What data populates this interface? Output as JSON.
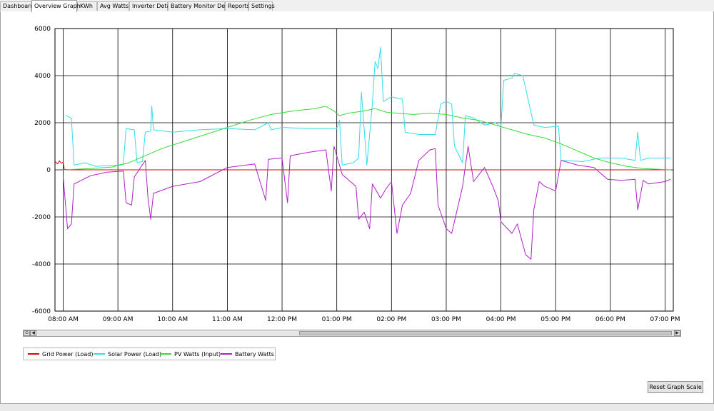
{
  "tabs": [
    {
      "label": "Dashboard",
      "active": false
    },
    {
      "label": "Overview Graph",
      "active": true
    },
    {
      "label": "KWh",
      "active": false
    },
    {
      "label": "Avg Watts",
      "active": false
    },
    {
      "label": "Inverter Detail",
      "active": false
    },
    {
      "label": "Battery Monitor Detail",
      "active": false
    },
    {
      "label": "Reports",
      "active": false
    },
    {
      "label": "Settings",
      "active": false
    }
  ],
  "reset_button": "Reset Graph Scale",
  "chart_data": {
    "type": "line",
    "x_ticks": [
      "08:00 AM",
      "09:00 AM",
      "10:00 AM",
      "11:00 AM",
      "12:00 PM",
      "01:00 PM",
      "02:00 PM",
      "03:00 PM",
      "04:00 PM",
      "05:00 PM",
      "06:00 PM",
      "07:00 PM"
    ],
    "y_ticks": [
      "6000",
      "4000",
      "2000",
      "0",
      "-2000",
      "-4000",
      "-6000"
    ],
    "ylim": [
      -6000,
      6000
    ],
    "xlim_hours": [
      7.85,
      19.15
    ],
    "grid": true,
    "legend_position": "bottom-left",
    "series": [
      {
        "name": "Grid Power (Load)",
        "color": "#e00000",
        "points": [
          [
            7.85,
            350
          ],
          [
            7.9,
            250
          ],
          [
            7.93,
            380
          ],
          [
            7.97,
            280
          ],
          [
            8.0,
            330
          ],
          [
            8.02,
            20
          ],
          [
            8.1,
            0
          ],
          [
            19.1,
            0
          ]
        ]
      },
      {
        "name": "Solar Power (Load)",
        "color": "#33dde8",
        "points": [
          [
            8.05,
            2300
          ],
          [
            8.15,
            2200
          ],
          [
            8.2,
            200
          ],
          [
            8.4,
            300
          ],
          [
            8.6,
            150
          ],
          [
            9.0,
            200
          ],
          [
            9.1,
            250
          ],
          [
            9.15,
            1750
          ],
          [
            9.3,
            1700
          ],
          [
            9.35,
            300
          ],
          [
            9.45,
            350
          ],
          [
            9.5,
            1600
          ],
          [
            9.6,
            1650
          ],
          [
            9.62,
            2700
          ],
          [
            9.65,
            1700
          ],
          [
            10.0,
            1600
          ],
          [
            10.5,
            1700
          ],
          [
            11.0,
            1750
          ],
          [
            11.5,
            1700
          ],
          [
            11.75,
            2000
          ],
          [
            11.8,
            1700
          ],
          [
            12.0,
            1800
          ],
          [
            12.5,
            1750
          ],
          [
            13.0,
            1750
          ],
          [
            13.05,
            2100
          ],
          [
            13.1,
            200
          ],
          [
            13.3,
            300
          ],
          [
            13.4,
            500
          ],
          [
            13.45,
            3300
          ],
          [
            13.55,
            200
          ],
          [
            13.6,
            1500
          ],
          [
            13.65,
            2800
          ],
          [
            13.7,
            4600
          ],
          [
            13.75,
            4300
          ],
          [
            13.8,
            5200
          ],
          [
            13.85,
            2900
          ],
          [
            14.0,
            3100
          ],
          [
            14.2,
            3000
          ],
          [
            14.25,
            1600
          ],
          [
            14.5,
            1500
          ],
          [
            14.8,
            1500
          ],
          [
            14.9,
            2800
          ],
          [
            15.0,
            2900
          ],
          [
            15.1,
            2800
          ],
          [
            15.15,
            1000
          ],
          [
            15.3,
            300
          ],
          [
            15.35,
            2300
          ],
          [
            15.5,
            2200
          ],
          [
            15.7,
            1900
          ],
          [
            15.9,
            2000
          ],
          [
            16.0,
            1800
          ],
          [
            16.05,
            3800
          ],
          [
            16.2,
            3900
          ],
          [
            16.25,
            4100
          ],
          [
            16.4,
            4000
          ],
          [
            16.6,
            1900
          ],
          [
            16.8,
            1800
          ],
          [
            17.05,
            1850
          ],
          [
            17.1,
            400
          ],
          [
            17.5,
            350
          ],
          [
            17.8,
            500
          ],
          [
            18.2,
            500
          ],
          [
            18.45,
            400
          ],
          [
            18.5,
            1600
          ],
          [
            18.55,
            400
          ],
          [
            18.7,
            500
          ],
          [
            19.0,
            500
          ],
          [
            19.1,
            500
          ]
        ]
      },
      {
        "name": "PV Watts (Input)",
        "color": "#33dd33",
        "points": [
          [
            8.0,
            0
          ],
          [
            8.5,
            50
          ],
          [
            8.9,
            120
          ],
          [
            9.2,
            300
          ],
          [
            9.5,
            600
          ],
          [
            9.8,
            900
          ],
          [
            10.2,
            1200
          ],
          [
            10.6,
            1500
          ],
          [
            11.0,
            1800
          ],
          [
            11.4,
            2100
          ],
          [
            11.8,
            2350
          ],
          [
            12.2,
            2500
          ],
          [
            12.6,
            2600
          ],
          [
            12.8,
            2700
          ],
          [
            12.95,
            2500
          ],
          [
            13.05,
            2300
          ],
          [
            13.2,
            2400
          ],
          [
            13.5,
            2500
          ],
          [
            13.7,
            2600
          ],
          [
            13.9,
            2450
          ],
          [
            14.1,
            2400
          ],
          [
            14.4,
            2350
          ],
          [
            14.7,
            2400
          ],
          [
            15.0,
            2350
          ],
          [
            15.3,
            2200
          ],
          [
            15.6,
            2100
          ],
          [
            15.9,
            1900
          ],
          [
            16.2,
            1700
          ],
          [
            16.5,
            1500
          ],
          [
            16.8,
            1350
          ],
          [
            17.1,
            1100
          ],
          [
            17.4,
            800
          ],
          [
            17.7,
            500
          ],
          [
            18.0,
            300
          ],
          [
            18.3,
            150
          ],
          [
            18.6,
            50
          ],
          [
            19.1,
            0
          ]
        ]
      },
      {
        "name": "Battery Watts",
        "color": "#b020c8",
        "points": [
          [
            8.0,
            -300
          ],
          [
            8.08,
            -2500
          ],
          [
            8.15,
            -2300
          ],
          [
            8.2,
            -600
          ],
          [
            8.5,
            -250
          ],
          [
            8.8,
            -100
          ],
          [
            9.1,
            -50
          ],
          [
            9.15,
            -1400
          ],
          [
            9.25,
            -1500
          ],
          [
            9.3,
            -300
          ],
          [
            9.5,
            400
          ],
          [
            9.55,
            -1200
          ],
          [
            9.6,
            -2100
          ],
          [
            9.65,
            -1000
          ],
          [
            10.0,
            -700
          ],
          [
            10.5,
            -500
          ],
          [
            11.0,
            100
          ],
          [
            11.5,
            250
          ],
          [
            11.7,
            -1300
          ],
          [
            11.75,
            450
          ],
          [
            12.0,
            500
          ],
          [
            12.1,
            -1400
          ],
          [
            12.15,
            600
          ],
          [
            12.5,
            750
          ],
          [
            12.8,
            850
          ],
          [
            12.9,
            -900
          ],
          [
            12.95,
            1000
          ],
          [
            13.1,
            -200
          ],
          [
            13.2,
            -400
          ],
          [
            13.35,
            -700
          ],
          [
            13.4,
            -2100
          ],
          [
            13.5,
            -1800
          ],
          [
            13.6,
            -2500
          ],
          [
            13.65,
            -600
          ],
          [
            13.8,
            -1200
          ],
          [
            13.9,
            -800
          ],
          [
            14.0,
            -500
          ],
          [
            14.1,
            -2700
          ],
          [
            14.2,
            -1500
          ],
          [
            14.35,
            -1000
          ],
          [
            14.5,
            400
          ],
          [
            14.7,
            850
          ],
          [
            14.8,
            900
          ],
          [
            14.85,
            -1500
          ],
          [
            15.0,
            -2500
          ],
          [
            15.1,
            -2700
          ],
          [
            15.3,
            -700
          ],
          [
            15.4,
            1000
          ],
          [
            15.5,
            -500
          ],
          [
            15.7,
            100
          ],
          [
            15.85,
            -700
          ],
          [
            15.95,
            -1300
          ],
          [
            16.0,
            -2200
          ],
          [
            16.2,
            -2700
          ],
          [
            16.3,
            -2300
          ],
          [
            16.45,
            -3600
          ],
          [
            16.55,
            -3800
          ],
          [
            16.6,
            -1700
          ],
          [
            16.7,
            -500
          ],
          [
            16.8,
            -700
          ],
          [
            17.0,
            -900
          ],
          [
            17.1,
            400
          ],
          [
            17.4,
            200
          ],
          [
            17.7,
            100
          ],
          [
            17.95,
            -400
          ],
          [
            18.2,
            -450
          ],
          [
            18.45,
            -400
          ],
          [
            18.5,
            -1700
          ],
          [
            18.6,
            -450
          ],
          [
            18.7,
            -600
          ],
          [
            19.0,
            -500
          ],
          [
            19.1,
            -400
          ]
        ]
      }
    ]
  }
}
